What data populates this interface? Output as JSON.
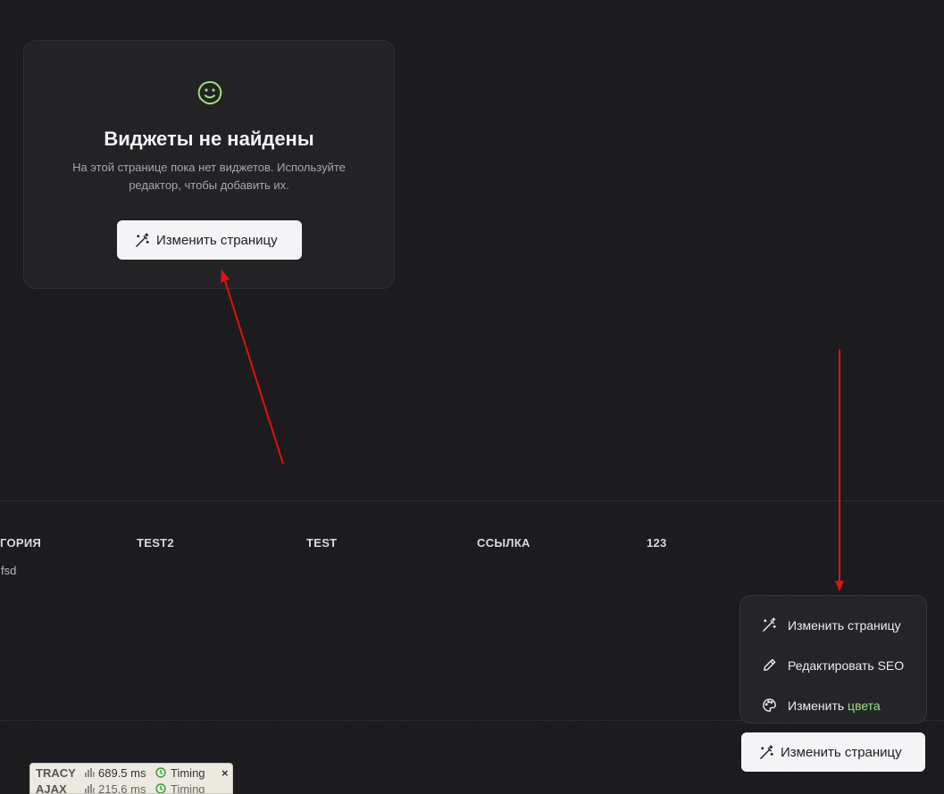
{
  "empty_state": {
    "title": "Виджеты не найдены",
    "description": "На этой странице пока нет виджетов. Используйте редактор, чтобы добавить их.",
    "button_label": "Изменить страницу",
    "icon": "smile-icon",
    "accent_color": "#9be27a"
  },
  "table": {
    "headers": [
      "ГОРИЯ",
      "TEST2",
      "TEST",
      "ССЫЛКА",
      "123"
    ],
    "cells": [
      "fsd"
    ]
  },
  "menu": {
    "items": [
      {
        "label": "Изменить страницу",
        "icon": "magic-wand-icon"
      },
      {
        "label": "Редактировать SEO",
        "icon": "pencil-icon"
      },
      {
        "label_prefix": "Изменить ",
        "label_accent": "цвета",
        "icon": "palette-icon"
      }
    ]
  },
  "fab": {
    "label": "Изменить страницу",
    "icon": "magic-wand-icon"
  },
  "tracy": {
    "rows": [
      {
        "name": "TRACY",
        "time": "689.5 ms",
        "timing": "Timing",
        "close": "×"
      },
      {
        "name": "AJAX",
        "time": "215.6 ms",
        "timing": "Timing"
      }
    ]
  },
  "annotation_color": "#e01010"
}
